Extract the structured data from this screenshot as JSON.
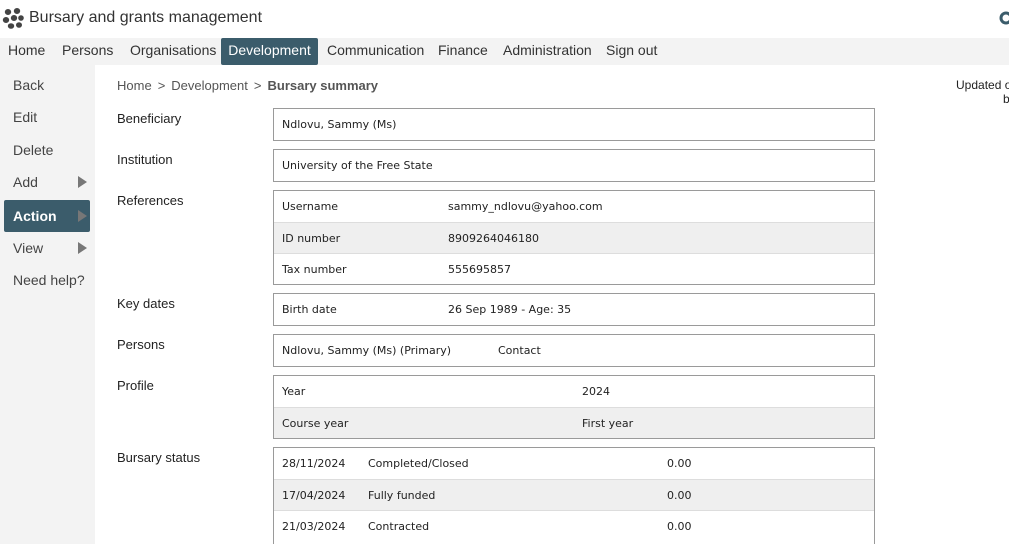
{
  "app": {
    "title": "Bursary and grants management",
    "logo_icon": "paw-logo-icon",
    "corner_icon": "refresh-icon"
  },
  "menu": {
    "items": [
      "Home",
      "Persons",
      "Organisations",
      "Development",
      "Communication",
      "Finance",
      "Administration",
      "Sign out"
    ],
    "active": "Development",
    "active_color": "#3b5c6b"
  },
  "sidebar": {
    "items": [
      {
        "label": "Back",
        "arrow": false
      },
      {
        "label": "Edit",
        "arrow": false
      },
      {
        "label": "Delete",
        "arrow": false
      },
      {
        "label": "Add",
        "arrow": true
      },
      {
        "label": "Action",
        "arrow": true,
        "active": true
      },
      {
        "label": "View",
        "arrow": true
      },
      {
        "label": "Need help?",
        "arrow": false
      }
    ]
  },
  "breadcrumb": {
    "items": [
      "Home",
      "Development"
    ],
    "separator": ">",
    "current": "Bursary summary"
  },
  "updated": {
    "line1": "Updated o",
    "line2": "b"
  },
  "fields": {
    "beneficiary": {
      "label": "Beneficiary",
      "value": "Ndlovu, Sammy (Ms)"
    },
    "institution": {
      "label": "Institution",
      "value": "University of the Free State"
    },
    "references": {
      "label": "References",
      "rows": [
        {
          "key": "Username",
          "value": "sammy_ndlovu@yahoo.com"
        },
        {
          "key": "ID number",
          "value": "8909264046180"
        },
        {
          "key": "Tax number",
          "value": "555695857"
        }
      ]
    },
    "key_dates": {
      "label": "Key dates",
      "rows": [
        {
          "key": "Birth date",
          "value": "26 Sep 1989 - Age: 35"
        }
      ]
    },
    "persons": {
      "label": "Persons",
      "rows": [
        {
          "name": "Ndlovu, Sammy (Ms) (Primary)",
          "role": "Contact"
        }
      ]
    },
    "profile": {
      "label": "Profile",
      "rows": [
        {
          "key": "Year",
          "value": "2024"
        },
        {
          "key": "Course year",
          "value": "First year"
        }
      ]
    },
    "bursary_status": {
      "label": "Bursary status",
      "rows": [
        {
          "date": "28/11/2024",
          "status": "Completed/Closed",
          "amount": "0.00"
        },
        {
          "date": "17/04/2024",
          "status": "Fully funded",
          "amount": "0.00"
        },
        {
          "date": "21/03/2024",
          "status": "Contracted",
          "amount": "0.00"
        }
      ]
    }
  }
}
